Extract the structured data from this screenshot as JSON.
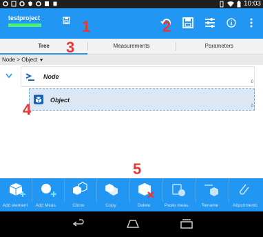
{
  "status_bar": {
    "time": "10:03"
  },
  "app_bar": {
    "title": "testproject"
  },
  "annotations": {
    "one": "1",
    "two": "2",
    "three": "3",
    "four": "4",
    "five": "5"
  },
  "tabs": [
    {
      "label": "Tree"
    },
    {
      "label": "Measurements"
    },
    {
      "label": "Parameters"
    }
  ],
  "breadcrumb": "Node > Object",
  "breadcrumb_arrow": "▼",
  "tree": {
    "node": {
      "label": "Node",
      "count": "0"
    },
    "object": {
      "label": "Object",
      "count": "0"
    }
  },
  "toolbar": [
    {
      "label": "Add element",
      "icon": "add-element-icon"
    },
    {
      "label": "Add Meas.",
      "icon": "add-measurement-icon"
    },
    {
      "label": "Clone",
      "icon": "clone-icon"
    },
    {
      "label": "Copy",
      "icon": "copy-icon"
    },
    {
      "label": "Delete",
      "icon": "delete-icon"
    },
    {
      "label": "Paste meas.",
      "icon": "paste-measurement-icon"
    },
    {
      "label": "Rename",
      "icon": "rename-icon"
    },
    {
      "label": "Attachments",
      "icon": "attachments-icon"
    }
  ],
  "colors": {
    "app_bar": "#2196f3",
    "annotation": "#e53935",
    "selected_row": "#dbe7f4",
    "subtitle_bar": "#49f07a"
  }
}
